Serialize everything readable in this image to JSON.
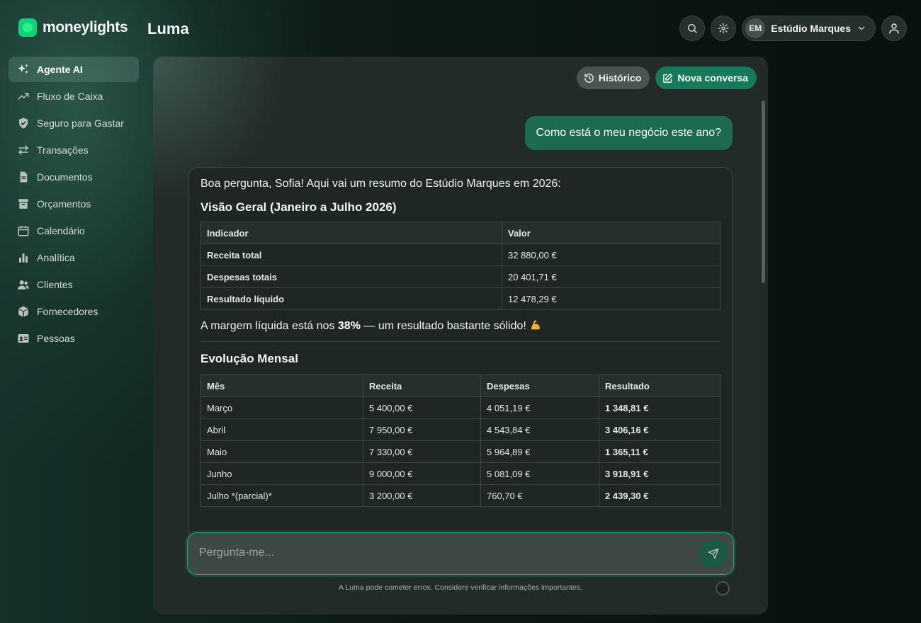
{
  "brand": {
    "name": "moneylights",
    "accent": "#10d27a"
  },
  "app": {
    "title": "Luma"
  },
  "top": {
    "org_initials": "EM",
    "org_name": "Estúdio Marques",
    "icons": [
      "search-icon",
      "gear-icon",
      "chevron-down-icon",
      "user-icon"
    ]
  },
  "sidebar": {
    "items": [
      {
        "label": "Agente AI",
        "icon": "sparkles-icon",
        "active": true
      },
      {
        "label": "Fluxo de Caixa",
        "icon": "trend-up-icon"
      },
      {
        "label": "Seguro para Gastar",
        "icon": "shield-check-icon"
      },
      {
        "label": "Transações",
        "icon": "arrows-swap-icon"
      },
      {
        "label": "Documentos",
        "icon": "document-icon"
      },
      {
        "label": "Orçamentos",
        "icon": "archive-box-icon"
      },
      {
        "label": "Calendário",
        "icon": "calendar-icon"
      },
      {
        "label": "Analítica",
        "icon": "bar-chart-icon"
      },
      {
        "label": "Clientes",
        "icon": "users-icon"
      },
      {
        "label": "Fornecedores",
        "icon": "cube-icon"
      },
      {
        "label": "Pessoas",
        "icon": "id-card-icon"
      }
    ]
  },
  "chat": {
    "history_label": "Histórico",
    "new_label": "Nova conversa",
    "user_message": "Como está o meu negócio este ano?",
    "ai": {
      "intro": "Boa pergunta, Sofia! Aqui vai um resumo do Estúdio Marques em 2026:",
      "overview_title": "Visão Geral (Janeiro a Julho 2026)",
      "overview_headers": [
        "Indicador",
        "Valor"
      ],
      "overview_rows": [
        [
          "Receita total",
          "32 880,00 €"
        ],
        [
          "Despesas totais",
          "20 401,71 €"
        ],
        [
          "Resultado líquido",
          "12 478,29 €"
        ]
      ],
      "margin_prefix": "A margem líquida está nos ",
      "margin_value": "38%",
      "margin_suffix": " — um resultado bastante sólido!",
      "monthly_title": "Evolução Mensal",
      "monthly_headers": [
        "Mês",
        "Receita",
        "Despesas",
        "Resultado"
      ],
      "monthly_rows": [
        [
          "Março",
          "5 400,00 €",
          "4 051,19 €",
          "1 348,81 €"
        ],
        [
          "Abril",
          "7 950,00 €",
          "4 543,84 €",
          "3 406,16 €"
        ],
        [
          "Maio",
          "7 330,00 €",
          "5 964,89 €",
          "1 365,11 €"
        ],
        [
          "Junho",
          "9 000,00 €",
          "5 081,09 €",
          "3 918,91 €"
        ],
        [
          "Julho *(parcial)*",
          "3 200,00 €",
          "760,70 €",
          "2 439,30 €"
        ]
      ]
    },
    "composer_placeholder": "Pergunta-me...",
    "disclaimer": "A Luma pode cometer erros. Considere verificar informações importantes."
  }
}
